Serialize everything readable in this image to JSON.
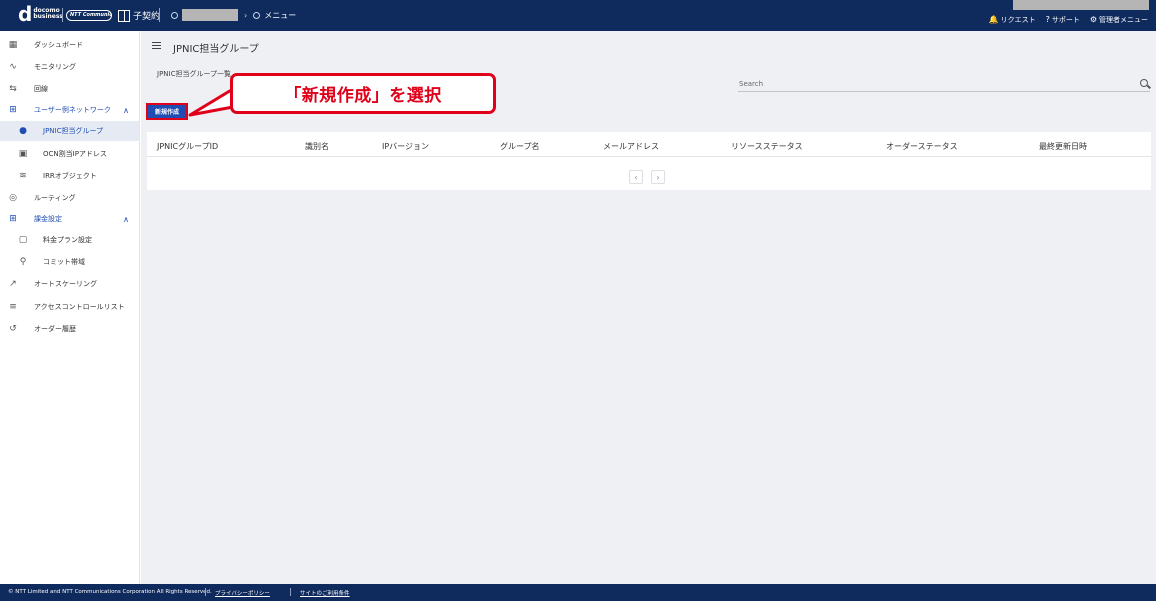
{
  "header": {
    "logo_mark": "d",
    "logo_line1": "docomo",
    "logo_line2": "business",
    "partner_logo": "NTT Communications",
    "contract_label": "子契約",
    "menu_label": "メニュー",
    "links": [
      {
        "icon": "bell-icon",
        "glyph": "🔔",
        "label": "リクエスト"
      },
      {
        "icon": "help-icon",
        "glyph": "?",
        "label": "サポート"
      },
      {
        "icon": "gear-icon",
        "glyph": "⚙",
        "label": "管理者メニュー"
      }
    ]
  },
  "sidebar": {
    "items": [
      {
        "icon": "dashboard-icon",
        "glyph": "▦",
        "label": "ダッシュボード"
      },
      {
        "icon": "monitoring-icon",
        "glyph": "∿",
        "label": "モニタリング"
      },
      {
        "icon": "line-icon",
        "glyph": "⇆",
        "label": "回線"
      },
      {
        "icon": "network-icon",
        "glyph": "⊞",
        "label": "ユーザー例ネットワーク",
        "caret": "∧"
      },
      {
        "icon": "user-icon",
        "glyph": "●",
        "label": "JPNIC担当グループ"
      },
      {
        "icon": "ip-icon",
        "glyph": "▣",
        "label": "OCN割当IPアドレス"
      },
      {
        "icon": "database-icon",
        "glyph": "≋",
        "label": "IRRオブジェクト"
      },
      {
        "icon": "routing-icon",
        "glyph": "◎",
        "label": "ルーティング"
      },
      {
        "icon": "billing-icon",
        "glyph": "⊞",
        "label": "課金設定",
        "caret": "∧"
      },
      {
        "icon": "plan-icon",
        "glyph": "▢",
        "label": "料金プラン設定"
      },
      {
        "icon": "commit-icon",
        "glyph": "⚲",
        "label": "コミット帯域"
      },
      {
        "icon": "autoscale-icon",
        "glyph": "↗",
        "label": "オートスケーリング"
      },
      {
        "icon": "acl-icon",
        "glyph": "≡",
        "label": "アクセスコントロールリスト"
      },
      {
        "icon": "history-icon",
        "glyph": "↺",
        "label": "オーダー履歴"
      }
    ]
  },
  "main": {
    "page_title": "JPNIC担当グループ",
    "list_title": "JPNIC担当グループ一覧",
    "new_button": "新規作成",
    "search_placeholder": "Search",
    "columns": [
      "JPNICグループID",
      "識別名",
      "IPバージョン",
      "グループ名",
      "メールアドレス",
      "リソースステータス",
      "オーダーステータス",
      "最終更新日時"
    ],
    "pager_prev": "‹",
    "pager_next": "›"
  },
  "callout": {
    "text": "「新規作成」を選択",
    "color": "#e0001a"
  },
  "footer": {
    "copyright": "© NTT Limited and NTT Communications Corporation All Rights Reserved.",
    "privacy": "プライバシーポリシー",
    "terms": "サイトのご利用条件"
  }
}
